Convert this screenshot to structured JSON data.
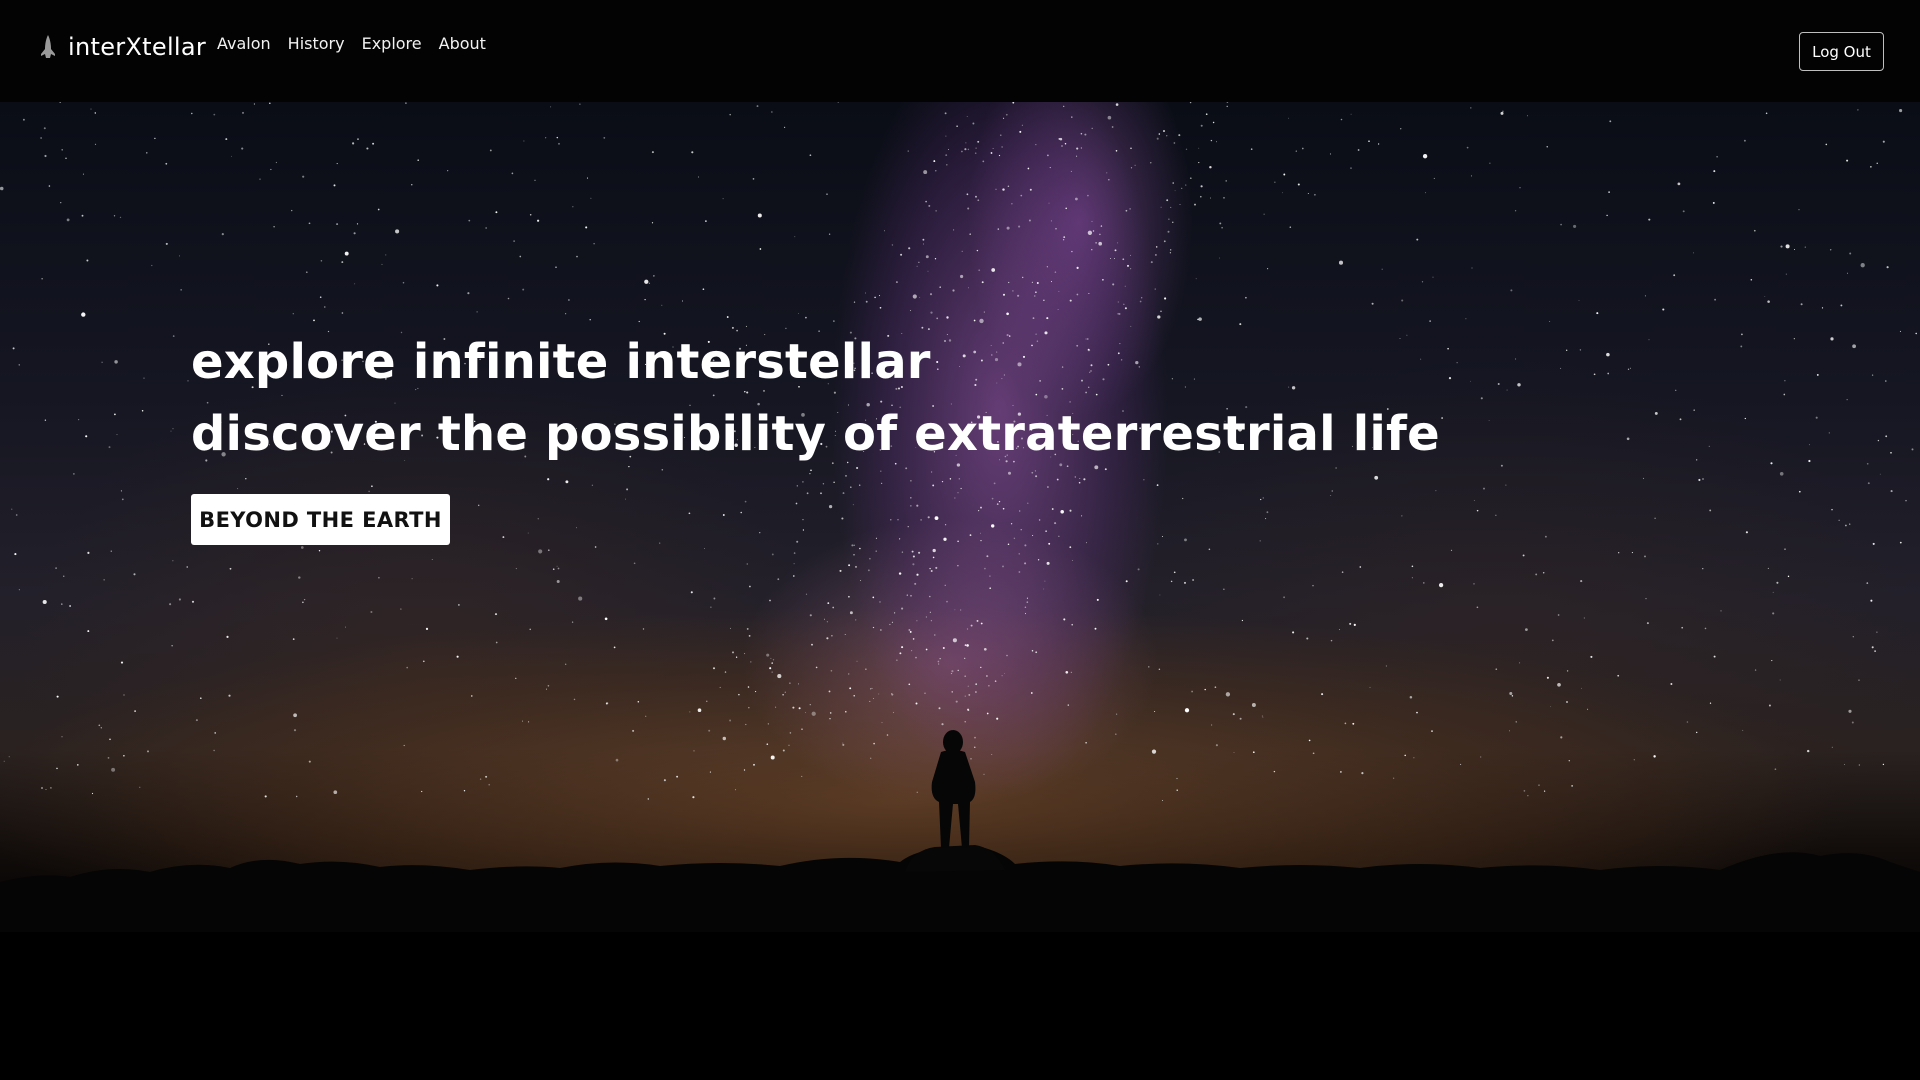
{
  "brand": {
    "icon": "rocket-icon",
    "name": "interXtellar"
  },
  "nav": {
    "links": [
      {
        "label": "Avalon"
      },
      {
        "label": "History"
      },
      {
        "label": "Explore"
      },
      {
        "label": "About"
      }
    ],
    "logout_label": "Log Out"
  },
  "hero": {
    "line1": "explore infinite interstellar",
    "line2": "discover the possibility of extraterrestrial life",
    "cta_label": "BEYOND THE EARTH"
  },
  "colors": {
    "nav_bg": "#030303",
    "cta_bg": "#ffffff",
    "cta_text": "#111111",
    "milky_way": "#a55cb9"
  }
}
